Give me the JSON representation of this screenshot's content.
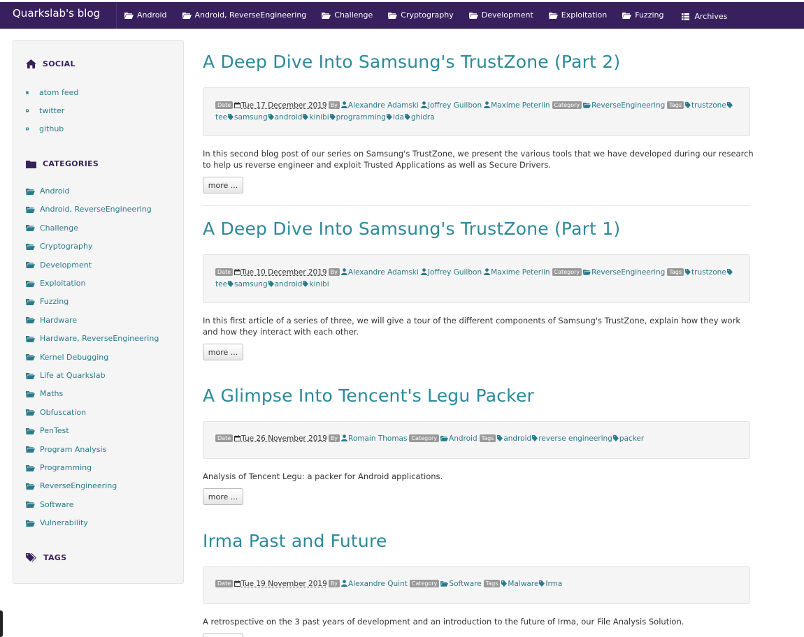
{
  "brand": "Quarkslab's blog",
  "nav": [
    "Android",
    "Android, ReverseEngineering",
    "Challenge",
    "Cryptography",
    "Development",
    "Exploitation",
    "Fuzzing"
  ],
  "nav_archives": "Archives",
  "sidebar": {
    "social_title": "SOCIAL",
    "social": [
      "atom feed",
      "twitter",
      "github"
    ],
    "categories_title": "CATEGORIES",
    "categories": [
      "Android",
      "Android, ReverseEngineering",
      "Challenge",
      "Cryptography",
      "Development",
      "Exploitation",
      "Fuzzing",
      "Hardware",
      "Hardware, ReverseEngineering",
      "Kernel Debugging",
      "Life at Quarkslab",
      "Maths",
      "Obfuscation",
      "PenTest",
      "Program Analysis",
      "Programming",
      "ReverseEngineering",
      "Software",
      "Vulnerability"
    ],
    "tags_title": "TAGS"
  },
  "labels": {
    "date": "Date",
    "by": "By",
    "category": "Category",
    "tags": "Tags"
  },
  "more_label": "more ...",
  "posts": [
    {
      "title": "A Deep Dive Into Samsung's TrustZone (Part 2)",
      "date": "Tue 17 December 2019",
      "authors": [
        "Alexandre Adamski",
        "Joffrey Guilbon",
        "Maxime Peterlin"
      ],
      "category": "ReverseEngineering",
      "tags": [
        "trustzone",
        "tee",
        "samsung",
        "android",
        "kinibi",
        "programming",
        "ida",
        "ghidra"
      ],
      "summary": "In this second blog post of our series on Samsung's TrustZone, we present the various tools that we have developed during our research to help us reverse engineer and exploit Trusted Applications as well as Secure Drivers."
    },
    {
      "title": "A Deep Dive Into Samsung's TrustZone (Part 1)",
      "date": "Tue 10 December 2019",
      "authors": [
        "Alexandre Adamski",
        "Joffrey Guilbon",
        "Maxime Peterlin"
      ],
      "category": "ReverseEngineering",
      "tags": [
        "trustzone",
        "tee",
        "samsung",
        "android",
        "kinibi"
      ],
      "summary": "In this first article of a series of three, we will give a tour of the different components of Samsung's TrustZone, explain how they work and how they interact with each other."
    },
    {
      "title": "A Glimpse Into Tencent's Legu Packer",
      "date": "Tue 26 November 2019",
      "authors": [
        "Romain Thomas"
      ],
      "category": "Android",
      "tags": [
        "android",
        "reverse engineering",
        "packer"
      ],
      "summary": "Analysis of Tencent Legu: a packer for Android applications."
    },
    {
      "title": "Irma Past and Future",
      "date": "Tue 19 November 2019",
      "authors": [
        "Alexandre Quint"
      ],
      "category": "Software",
      "tags": [
        "Malware",
        "Irma"
      ],
      "summary": "A retrospective on the 3 past years of development and an introduction to the future of Irma, our File Analysis Solution."
    }
  ],
  "colors": {
    "nav_bg": "#38205e",
    "link": "#2b7a8c",
    "title": "#2b8a99",
    "panel": "#f5f5f5"
  }
}
